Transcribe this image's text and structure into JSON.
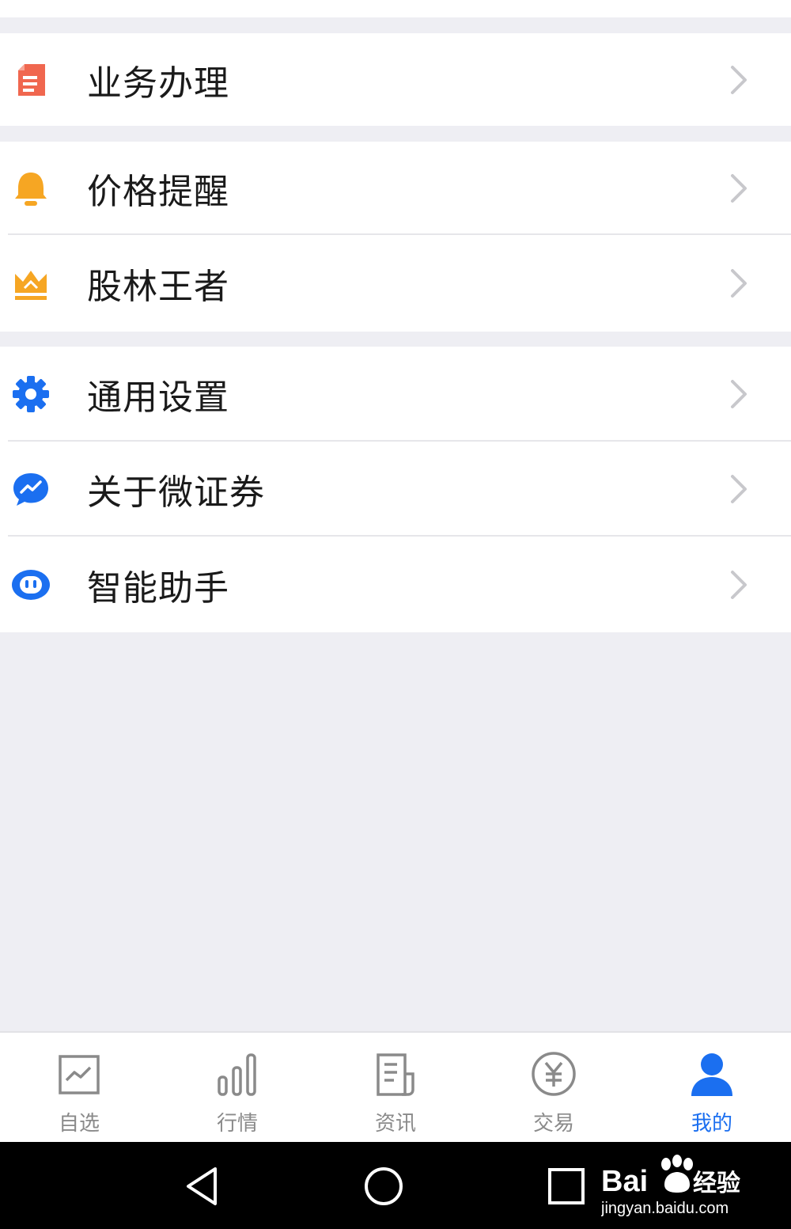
{
  "menu": {
    "group1": [
      {
        "label": "业务办理",
        "icon": "document-icon",
        "color": "#f0674f"
      }
    ],
    "group2": [
      {
        "label": "价格提醒",
        "icon": "bell-icon",
        "color": "#f6a623"
      },
      {
        "label": "股林王者",
        "icon": "crown-icon",
        "color": "#f6a623"
      }
    ],
    "group3": [
      {
        "label": "通用设置",
        "icon": "gear-icon",
        "color": "#1b6ff0"
      },
      {
        "label": "关于微证券",
        "icon": "chat-chart-icon",
        "color": "#1b6ff0"
      },
      {
        "label": "智能助手",
        "icon": "robot-icon",
        "color": "#1b6ff0"
      }
    ]
  },
  "tabbar": {
    "tabs": [
      {
        "label": "自选",
        "icon": "watchlist-chart-icon",
        "active": false
      },
      {
        "label": "行情",
        "icon": "bar-chart-icon",
        "active": false
      },
      {
        "label": "资讯",
        "icon": "news-icon",
        "active": false
      },
      {
        "label": "交易",
        "icon": "yen-circle-icon",
        "active": false
      },
      {
        "label": "我的",
        "icon": "person-icon",
        "active": true
      }
    ],
    "inactive_color": "#8a8a8a",
    "active_color": "#1b6ff0"
  },
  "watermark": {
    "brand": "Bai",
    "brand_tail": "经验",
    "url": "jingyan.baidu.com"
  }
}
